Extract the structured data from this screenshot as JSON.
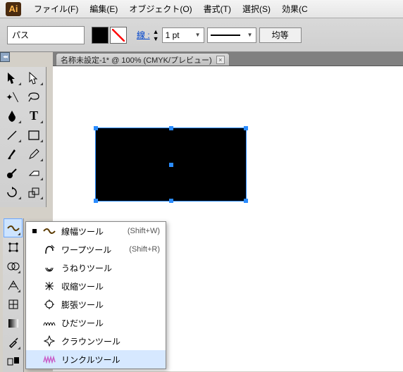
{
  "menubar": {
    "items": [
      "ファイル(F)",
      "編集(E)",
      "オブジェクト(O)",
      "書式(T)",
      "選択(S)",
      "効果(C"
    ]
  },
  "control": {
    "context_label": "パス",
    "stroke_label": "線 :",
    "stroke_weight": "1 pt",
    "equal_label": "均等"
  },
  "tab": {
    "title": "名称未設定-1* @ 100% (CMYK/プレビュー)"
  },
  "flyout": {
    "items": [
      {
        "label": "線幅ツール",
        "shortcut": "(Shift+W)",
        "current": true
      },
      {
        "label": "ワープツール",
        "shortcut": "(Shift+R)",
        "current": false
      },
      {
        "label": "うねりツール",
        "shortcut": "",
        "current": false
      },
      {
        "label": "収縮ツール",
        "shortcut": "",
        "current": false
      },
      {
        "label": "膨張ツール",
        "shortcut": "",
        "current": false
      },
      {
        "label": "ひだツール",
        "shortcut": "",
        "current": false
      },
      {
        "label": "クラウンツール",
        "shortcut": "",
        "current": false
      },
      {
        "label": "リンクルツール",
        "shortcut": "",
        "current": false
      }
    ]
  }
}
